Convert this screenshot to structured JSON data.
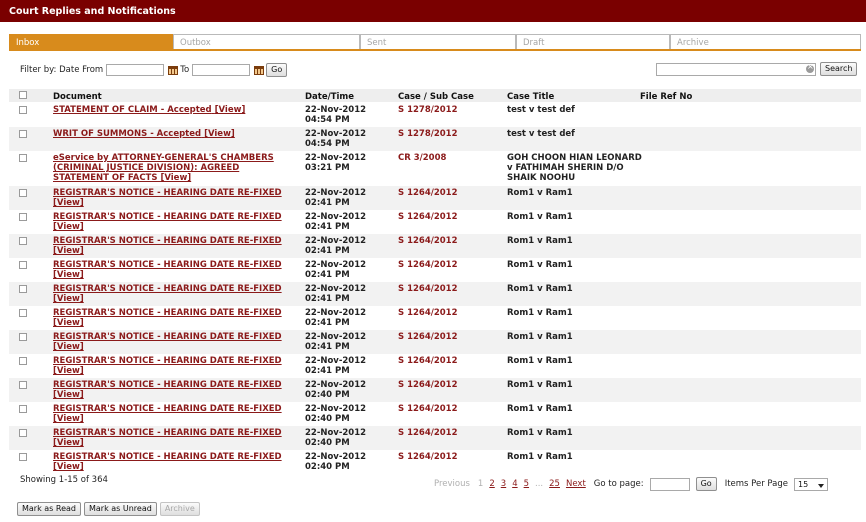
{
  "window": {
    "title": "Court Replies and Notifications"
  },
  "tabs": [
    {
      "label": "Inbox",
      "active": true
    },
    {
      "label": "Outbox",
      "active": false
    },
    {
      "label": "Sent",
      "active": false
    },
    {
      "label": "Draft",
      "active": false
    },
    {
      "label": "Archive",
      "active": false
    }
  ],
  "filter": {
    "label": "Filter by: Date From",
    "to_label": "To",
    "from_value": "",
    "to_value": "",
    "go_label": "Go"
  },
  "search": {
    "value": "",
    "button_label": "Search"
  },
  "columns": {
    "document": "Document",
    "datetime": "Date/Time",
    "case": "Case / Sub Case",
    "title": "Case Title",
    "fileref": "File Ref No"
  },
  "rows": [
    {
      "doc": "STATEMENT OF CLAIM - Accepted",
      "view": "[View]",
      "date": "22-Nov-2012",
      "time": "04:54 PM",
      "case": "S 1278/2012",
      "title": "test v test def"
    },
    {
      "doc": "WRIT OF SUMMONS - Accepted",
      "view": "[View]",
      "date": "22-Nov-2012",
      "time": "04:54 PM",
      "case": "S 1278/2012",
      "title": "test v test def"
    },
    {
      "doc": "eService by ATTORNEY-GENERAL'S CHAMBERS (CRIMINAL JUSTICE DIVISION): AGREED STATEMENT OF FACTS",
      "view": "[View]",
      "date": "22-Nov-2012",
      "time": "03:21 PM",
      "case": "CR 3/2008",
      "title": "GOH CHOON HIAN LEONARD v FATHIMAH SHERIN D/O SHAIK NOOHU"
    },
    {
      "doc": "REGISTRAR'S NOTICE - HEARING DATE RE-FIXED",
      "view": "[View]",
      "date": "22-Nov-2012",
      "time": "02:41 PM",
      "case": "S 1264/2012",
      "title": "Rom1 v Ram1"
    },
    {
      "doc": "REGISTRAR'S NOTICE - HEARING DATE RE-FIXED",
      "view": "[View]",
      "date": "22-Nov-2012",
      "time": "02:41 PM",
      "case": "S 1264/2012",
      "title": "Rom1 v Ram1"
    },
    {
      "doc": "REGISTRAR'S NOTICE - HEARING DATE RE-FIXED",
      "view": "[View]",
      "date": "22-Nov-2012",
      "time": "02:41 PM",
      "case": "S 1264/2012",
      "title": "Rom1 v Ram1"
    },
    {
      "doc": "REGISTRAR'S NOTICE - HEARING DATE RE-FIXED",
      "view": "[View]",
      "date": "22-Nov-2012",
      "time": "02:41 PM",
      "case": "S 1264/2012",
      "title": "Rom1 v Ram1"
    },
    {
      "doc": "REGISTRAR'S NOTICE - HEARING DATE RE-FIXED",
      "view": "[View]",
      "date": "22-Nov-2012",
      "time": "02:41 PM",
      "case": "S 1264/2012",
      "title": "Rom1 v Ram1"
    },
    {
      "doc": "REGISTRAR'S NOTICE - HEARING DATE RE-FIXED",
      "view": "[View]",
      "date": "22-Nov-2012",
      "time": "02:41 PM",
      "case": "S 1264/2012",
      "title": "Rom1 v Ram1"
    },
    {
      "doc": "REGISTRAR'S NOTICE - HEARING DATE RE-FIXED",
      "view": "[View]",
      "date": "22-Nov-2012",
      "time": "02:41 PM",
      "case": "S 1264/2012",
      "title": "Rom1 v Ram1"
    },
    {
      "doc": "REGISTRAR'S NOTICE - HEARING DATE RE-FIXED",
      "view": "[View]",
      "date": "22-Nov-2012",
      "time": "02:41 PM",
      "case": "S 1264/2012",
      "title": "Rom1 v Ram1"
    },
    {
      "doc": "REGISTRAR'S NOTICE - HEARING DATE RE-FIXED",
      "view": "[View]",
      "date": "22-Nov-2012",
      "time": "02:40 PM",
      "case": "S 1264/2012",
      "title": "Rom1 v Ram1"
    },
    {
      "doc": "REGISTRAR'S NOTICE - HEARING DATE RE-FIXED",
      "view": "[View]",
      "date": "22-Nov-2012",
      "time": "02:40 PM",
      "case": "S 1264/2012",
      "title": "Rom1 v Ram1"
    },
    {
      "doc": "REGISTRAR'S NOTICE - HEARING DATE RE-FIXED",
      "view": "[View]",
      "date": "22-Nov-2012",
      "time": "02:40 PM",
      "case": "S 1264/2012",
      "title": "Rom1 v Ram1"
    },
    {
      "doc": "REGISTRAR'S NOTICE - HEARING DATE RE-FIXED",
      "view": "[View]",
      "date": "22-Nov-2012",
      "time": "02:40 PM",
      "case": "S 1264/2012",
      "title": "Rom1 v Ram1"
    }
  ],
  "footer": {
    "showing": "Showing 1-15 of 364",
    "previous": "Previous",
    "current_page": "1",
    "pages": [
      "2",
      "3",
      "4",
      "5"
    ],
    "ellipsis": "...",
    "last_page": "25",
    "next": "Next",
    "goto_label": "Go to page:",
    "goto_value": "",
    "go_label": "Go",
    "items_per_page_label": "Items Per Page",
    "items_per_page": "15"
  },
  "actions": {
    "mark_read": "Mark as Read",
    "mark_unread": "Mark as Unread",
    "archive": "Archive"
  }
}
